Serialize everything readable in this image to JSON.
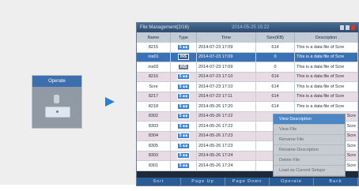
{
  "operate_card": {
    "label": "Operate"
  },
  "screen": {
    "title": "File Management(2/16)",
    "datetime": "2014-05-25 15:22",
    "columns": [
      "Name",
      "Type",
      "Time",
      "Size(KB)",
      "Description"
    ],
    "rows": [
      {
        "name": "8215",
        "type": "5 ∎∎",
        "time": "2014-07-23 17:09",
        "size": "614",
        "desc": "This is a data file of Scre"
      },
      {
        "name": "ins01",
        "type": "INS",
        "time": "2014-07-23 17:09",
        "size": "0",
        "desc": "This is a data file of Scre"
      },
      {
        "name": "ins02",
        "type": "INS",
        "time": "2014-07-23 17:09",
        "size": "0",
        "desc": "This is a data file of Scre"
      },
      {
        "name": "8216",
        "type": "5 ∎∎",
        "time": "2014-07-23 17:10",
        "size": "614",
        "desc": "This is a data file of Scre"
      },
      {
        "name": "Scre",
        "type": "5 ∎∎",
        "time": "2014-07-23 17:10",
        "size": "614",
        "desc": "This is a data file of Scre"
      },
      {
        "name": "8217",
        "type": "5 ∎∎",
        "time": "2014-07-23 17:11",
        "size": "614",
        "desc": "This is a data file of Scre"
      },
      {
        "name": "8218",
        "type": "5 ∎∎",
        "time": "2014-05-26 17:20",
        "size": "614",
        "desc": "This is a data file of Scre"
      },
      {
        "name": "8302",
        "type": "5 ∎∎",
        "time": "2014-05-26 17:22",
        "size": "",
        "desc": "Scre"
      },
      {
        "name": "8303",
        "type": "5 ∎∎",
        "time": "2014-05-26 17:22",
        "size": "",
        "desc": "Scre"
      },
      {
        "name": "8304",
        "type": "5 ∎∎",
        "time": "2014-05-26 17:23",
        "size": "",
        "desc": "Scre"
      },
      {
        "name": "8305",
        "type": "5 ∎∎",
        "time": "2014-05-26 17:23",
        "size": "",
        "desc": "Scre"
      },
      {
        "name": "8303",
        "type": "5 ∎∎",
        "time": "2014-05-26 17:24",
        "size": "",
        "desc": "Scre"
      },
      {
        "name": "8301",
        "type": "5 ∎∎",
        "time": "2014-05-26 17:24",
        "size": "",
        "desc": "Scre"
      }
    ],
    "context_menu": [
      "View Description",
      "View File",
      "Rename File",
      "Rename Description",
      "Delete File",
      "Load as Current Setups"
    ],
    "bottom_buttons": [
      "Sort",
      "Page Up",
      "Page Down",
      "Operate",
      "Back"
    ]
  }
}
